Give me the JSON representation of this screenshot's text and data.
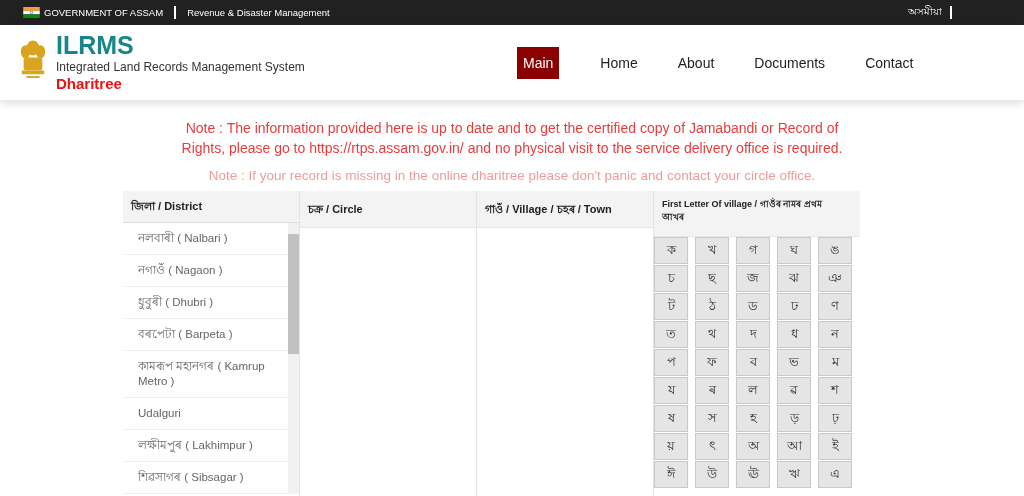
{
  "top_bar": {
    "government": "GOVERNMENT OF ASSAM",
    "department": "Revenue & Disaster Management",
    "language": "অসমীয়া"
  },
  "brand": {
    "title": "ILRMS",
    "subtitle": "Integrated Land Records Management System",
    "tagline": "Dharitree"
  },
  "nav": [
    {
      "label": "Main",
      "selected": true
    },
    {
      "label": "Home",
      "selected": false
    },
    {
      "label": "About",
      "selected": false
    },
    {
      "label": "Documents",
      "selected": false
    },
    {
      "label": "Contact",
      "selected": false
    }
  ],
  "notes": [
    {
      "text": "Note : The information provided here is up to date and to get the certified copy of Jamabandi or Record of Rights, please go to https://rtps.assam.gov.in/ and no physical visit to the service delivery office is required.",
      "kind": "strong"
    },
    {
      "text": "Note : If your record is missing in the online dharitree please don't panic and contact your circle office.",
      "kind": "light"
    }
  ],
  "columns": {
    "district": "জিলা / District",
    "circle": "চক্ৰ / Circle",
    "village": "গাওঁ / Village / চহৰ / Town",
    "letters": "First Letter Of village / গাওঁৰ নামৰ প্ৰথম আখৰ"
  },
  "districts": [
    "নলবাৰী ( Nalbari )",
    "নগাওঁ ( Nagaon )",
    "ধুবুৰী ( Dhubri )",
    "বৰপেটা ( Barpeta )",
    "কামৰূপ মহানগৰ ( Kamrup Metro )",
    "Udalguri",
    "লক্ষীমপুৰ ( Lakhimpur )",
    "শিৱসাগৰ ( Sibsagar )"
  ],
  "letters": [
    "ক",
    "খ",
    "গ",
    "ঘ",
    "ঙ",
    "চ",
    "ছ",
    "জ",
    "ঝ",
    "ঞ",
    "ট",
    "ঠ",
    "ড",
    "ঢ",
    "ণ",
    "ত",
    "থ",
    "দ",
    "ধ",
    "ন",
    "প",
    "ফ",
    "ব",
    "ভ",
    "ম",
    "য",
    "ৰ",
    "ল",
    "ৱ",
    "শ",
    "ষ",
    "স",
    "হ",
    "ড়",
    "ঢ়",
    "য়",
    "ৎ",
    "অ",
    "আ",
    "ই",
    "ঈ",
    "উ",
    "ঊ",
    "ঋ",
    "এ"
  ]
}
